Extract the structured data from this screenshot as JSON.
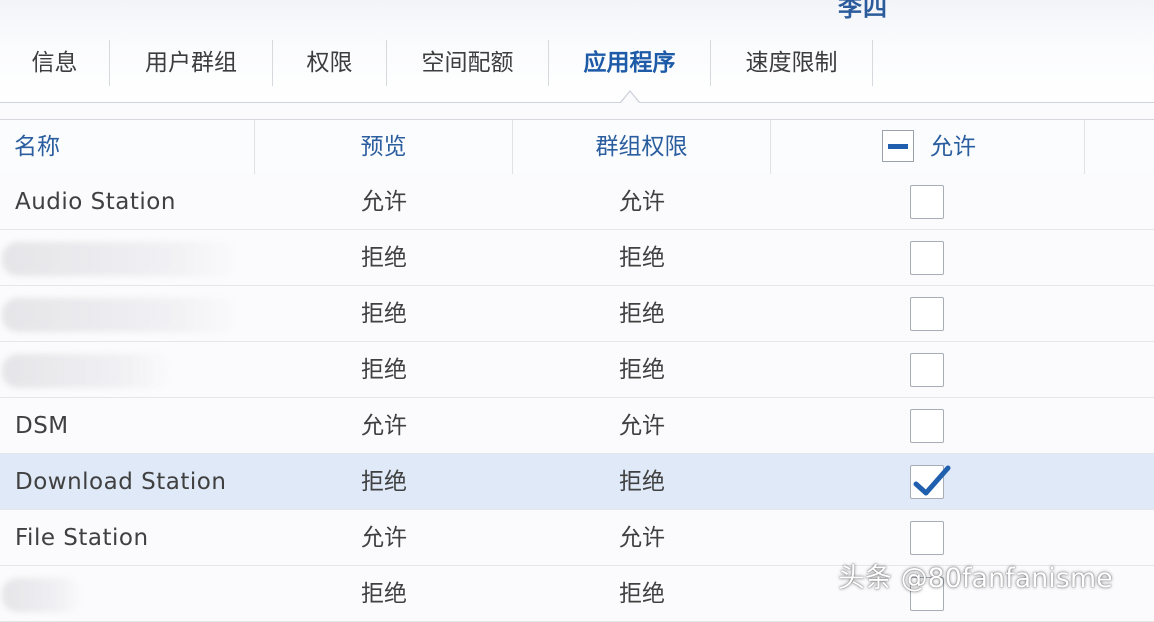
{
  "header": {
    "user_name": "李四"
  },
  "tabs": [
    {
      "label": "信息",
      "active": false
    },
    {
      "label": "用户群组",
      "active": false
    },
    {
      "label": "权限",
      "active": false
    },
    {
      "label": "空间配额",
      "active": false
    },
    {
      "label": "应用程序",
      "active": true
    },
    {
      "label": "速度限制",
      "active": false
    }
  ],
  "table": {
    "headers": {
      "name": "名称",
      "preview": "预览",
      "group": "群组权限",
      "allow": "允许"
    },
    "header_allow_checkbox_state": "indeterminate",
    "rows": [
      {
        "name": "Audio Station",
        "preview": "允许",
        "group": "允许",
        "checked": false,
        "selected": false,
        "name_blurred": false
      },
      {
        "name": "",
        "preview": "拒绝",
        "group": "拒绝",
        "checked": false,
        "selected": false,
        "name_blurred": true
      },
      {
        "name": "",
        "preview": "拒绝",
        "group": "拒绝",
        "checked": false,
        "selected": false,
        "name_blurred": true
      },
      {
        "name": "",
        "preview": "拒绝",
        "group": "拒绝",
        "checked": false,
        "selected": false,
        "name_blurred": true
      },
      {
        "name": "DSM",
        "preview": "允许",
        "group": "允许",
        "checked": false,
        "selected": false,
        "name_blurred": false
      },
      {
        "name": "Download Station",
        "preview": "拒绝",
        "group": "拒绝",
        "checked": true,
        "selected": true,
        "name_blurred": false
      },
      {
        "name": "File Station",
        "preview": "允许",
        "group": "允许",
        "checked": false,
        "selected": false,
        "name_blurred": false
      },
      {
        "name": "",
        "preview": "拒绝",
        "group": "拒绝",
        "checked": false,
        "selected": false,
        "name_blurred": true
      }
    ]
  },
  "watermark": "头条 @80fanfanisme",
  "colors": {
    "accent": "#1d5ba8",
    "selected_row": "#dfe9f7",
    "check": "#1f5fae"
  }
}
